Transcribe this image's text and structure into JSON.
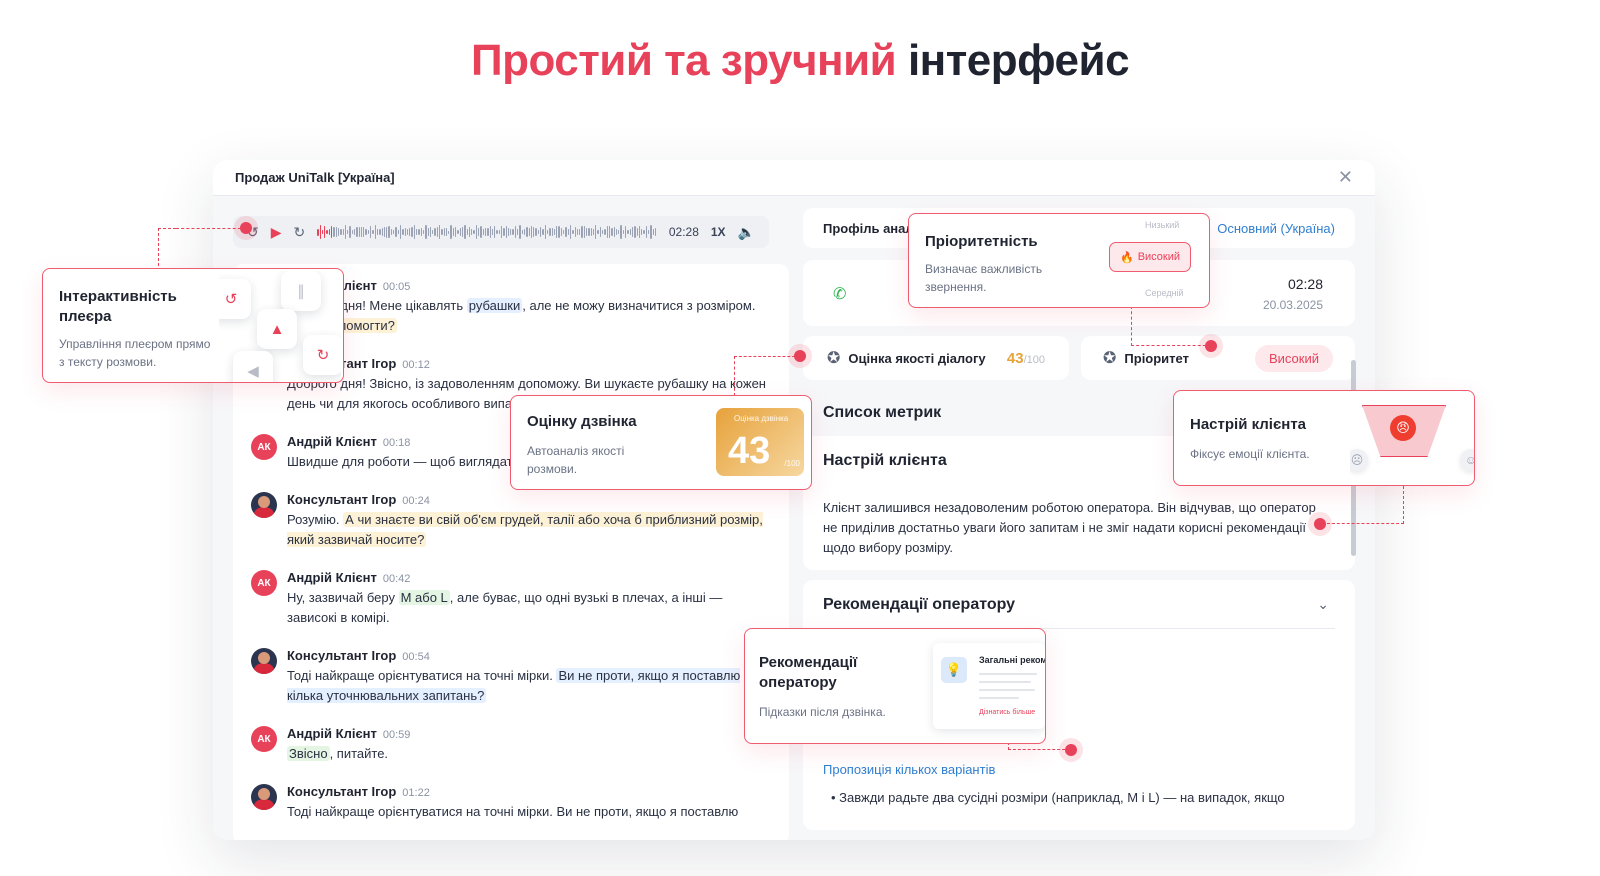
{
  "headline": {
    "red": "Простий та зручний",
    "dark": "інтерфейс"
  },
  "window": {
    "title": "Продаж UniTalk [Україна]",
    "close_icon": "close-icon"
  },
  "player": {
    "time": "02:28",
    "speed": "1X",
    "progress": 0.05
  },
  "messages": [
    {
      "avatar": "",
      "name": "Андрій Клієнт",
      "time": "00:05",
      "parts": [
        [
          "",
          "Доброго дня! Мене цікавлять "
        ],
        [
          "b",
          "рубашки"
        ],
        [
          "",
          ", але не можу визначитися з розміром. Можете "
        ],
        [
          "y",
          "помогти?"
        ]
      ]
    },
    {
      "avatar": "",
      "name": "Консультант Ігор",
      "time": "00:12",
      "parts": [
        [
          "",
          "Доброго дня! Звісно, із задоволенням допоможу. Ви шукаєте рубашку на кожен день чи для якогось особливого випадку?"
        ]
      ]
    },
    {
      "avatar": "АК",
      "name": "Андрій Клієнт",
      "time": "00:18",
      "parts": [
        [
          "",
          "Швидше для роботи — щоб виглядати стильно та акуратно."
        ]
      ]
    },
    {
      "avatar": "",
      "name": "Консультант Ігор",
      "time": "00:24",
      "parts": [
        [
          "",
          "Розумію. "
        ],
        [
          "y",
          "А чи знаєте ви свій об'єм грудей, талії або хоча б приблизний розмір, який зазвичай носите?"
        ]
      ]
    },
    {
      "avatar": "АК",
      "name": "Андрій Клієнт",
      "time": "00:42",
      "parts": [
        [
          "",
          "Ну, зазвичай беру "
        ],
        [
          "g",
          "M або L"
        ],
        [
          "",
          ", але буває, що одні вузькі в плечах, а інші — зависокі в комірі."
        ]
      ]
    },
    {
      "avatar": "",
      "name": "Консультант Ігор",
      "time": "00:54",
      "parts": [
        [
          "",
          "Тоді найкраще орієнтуватися на точні мірки. "
        ],
        [
          "b",
          "Ви не проти, якщо я поставлю кілька уточнювальних запитань?"
        ]
      ]
    },
    {
      "avatar": "АК",
      "name": "Андрій Клієнт",
      "time": "00:59",
      "parts": [
        [
          "g",
          "Звісно"
        ],
        [
          "",
          ", питайте."
        ]
      ]
    },
    {
      "avatar": "",
      "name": "Консультант Ігор",
      "time": "01:22",
      "parts": [
        [
          "",
          "Тоді найкраще орієнтуватися на точні мірки. Ви не проти, якщо я поставлю"
        ]
      ]
    }
  ],
  "profile": {
    "title": "Профіль аналізу",
    "lang": "Основний (Україна)"
  },
  "call": {
    "time": "02:28",
    "date": "20.03.2025"
  },
  "quality": {
    "title": "Оцінка якості діалогу",
    "value": "43",
    "max": "/100"
  },
  "priority": {
    "title": "Пріоритет",
    "value": "Високий"
  },
  "metrics_title": "Список метрик",
  "mood": {
    "title": "Настрій клієнта",
    "text": "Клієнт залишився незадоволеним роботою оператора. Він відчував, що оператор не приділив достатньо уваги його запитам і не зміг надати корисні рекомендації щодо вибору розміру."
  },
  "recommendations": {
    "title": "Рекомендації оператору",
    "subtitle": "Пропозиція кількох варіантів",
    "bullet": "Завжди радьте два сусідні розміри (наприклад, M і L) — на випадок, якщо"
  },
  "callouts": {
    "player": {
      "title": "Інтерактивність плеєра",
      "desc": "Управління плеєром прямо з тексту розмови."
    },
    "score": {
      "title": "Оцінку дзвінка",
      "desc": "Автоаналіз якості розмови.",
      "tile_label": "Оцінка дзвінка",
      "tile_value": "43",
      "tile_max": "/100"
    },
    "priority": {
      "title": "Пріоритетність",
      "desc": "Визначає важливість звернення.",
      "pill": "Високий",
      "faint_top": "Низький",
      "faint_bottom": "Середній"
    },
    "mood": {
      "title": "Настрій клієнта",
      "desc": "Фіксує емоції клієнта."
    },
    "rec": {
      "title": "Рекомендації оператору",
      "desc": "Підказки після дзвінка.",
      "thumb_title": "Загальні рекомендації",
      "thumb_link": "Дізнатись більше"
    }
  },
  "colors": {
    "accent": "#e8415a",
    "link": "#2f7fd0",
    "score": "#e5a43a"
  }
}
